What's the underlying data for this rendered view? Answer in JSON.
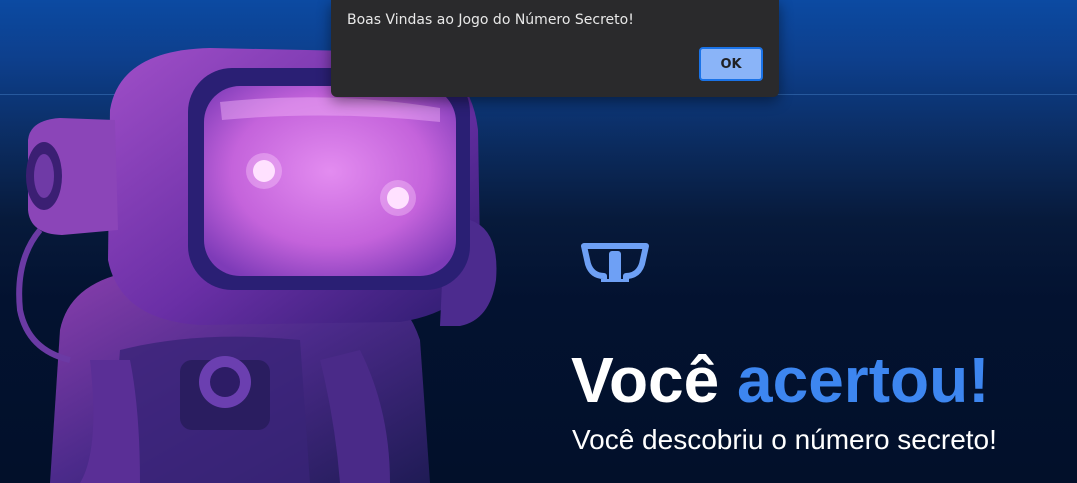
{
  "alert": {
    "message": "Boas Vindas ao Jogo do Número Secreto!",
    "ok_label": "OK"
  },
  "game": {
    "title_main": "Você ",
    "title_accent": "acertou!",
    "subtitle": "Você descobriu o número secreto!"
  },
  "colors": {
    "accent": "#3d86f0",
    "background_top": "#0c4aa2",
    "background_bottom": "#02102a",
    "visor": "#c86adf"
  },
  "icons": {
    "logo": "nlw-cup-logo-icon",
    "hero": "robot-astronaut-illustration"
  }
}
